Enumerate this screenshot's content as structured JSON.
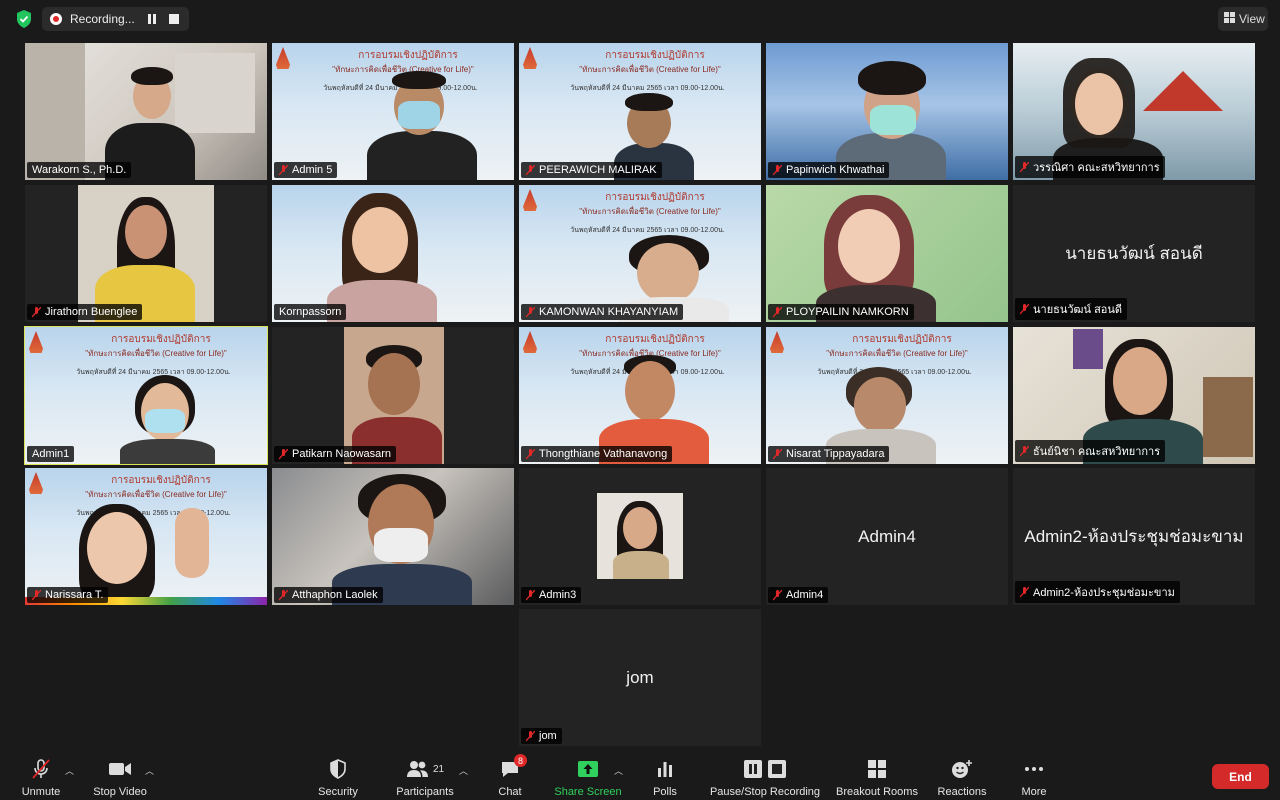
{
  "top": {
    "recording_label": "Recording...",
    "view_label": "View"
  },
  "participants": [
    {
      "name": "Warakorn S., Ph.D.",
      "muted": false
    },
    {
      "name": "Admin 5",
      "muted": true
    },
    {
      "name": "PEERAWICH MALIRAK",
      "muted": true
    },
    {
      "name": "Papinwich Khwathai",
      "muted": true
    },
    {
      "name": "วรรณิศา คณะสหวิทยาการ",
      "muted": true
    },
    {
      "name": "Jirathorn Buenglee",
      "muted": true
    },
    {
      "name": "Kornpassorn",
      "muted": false
    },
    {
      "name": "KAMONWAN KHAYANYIAM",
      "muted": true
    },
    {
      "name": "PLOYPAILIN NAMKORN",
      "muted": true
    },
    {
      "name": "นายธนวัฒน์ สอนดี",
      "muted": true,
      "display": "นายธนวัฒน์ สอนดี"
    },
    {
      "name": "Admin1",
      "muted": false
    },
    {
      "name": "Patikarn Naowasarn",
      "muted": true
    },
    {
      "name": "Thongthiane Vathanavong",
      "muted": true
    },
    {
      "name": "Nisarat Tippayadara",
      "muted": true
    },
    {
      "name": "ธันย์นิชา คณะสหวิทยาการ",
      "muted": true
    },
    {
      "name": "Narissara T.",
      "muted": true
    },
    {
      "name": "Atthaphon Laolek",
      "muted": true
    },
    {
      "name": "Admin3",
      "muted": true
    },
    {
      "name": "Admin4",
      "muted": true,
      "display": "Admin4"
    },
    {
      "name": "Admin2-ห้องประชุมช่อมะขาม",
      "muted": true,
      "display": "Admin2-ห้องประชุมช่อมะขาม"
    },
    {
      "name": "jom",
      "muted": true,
      "display": "jom"
    }
  ],
  "slide": {
    "title": "การอบรมเชิงปฏิบัติการ",
    "subtitle": "\"ทักษะการคิดเพื่อชีวิต (Creative for Life)\"",
    "date": "วันพฤหัสบดีที่ 24 มีนาคม 2565 เวลา 09.00-12.00น."
  },
  "toolbar": {
    "unmute": "Unmute",
    "stop_video": "Stop Video",
    "security": "Security",
    "participants": "Participants",
    "participants_count": "21",
    "chat": "Chat",
    "chat_badge": "8",
    "share_screen": "Share Screen",
    "polls": "Polls",
    "recording": "Pause/Stop Recording",
    "breakout": "Breakout Rooms",
    "reactions": "Reactions",
    "more": "More",
    "end": "End"
  },
  "colors": {
    "active_speaker": "#d8e35a",
    "share_green": "#2fd15c",
    "end_red": "#d42a2a",
    "muted_red": "#e02828"
  }
}
